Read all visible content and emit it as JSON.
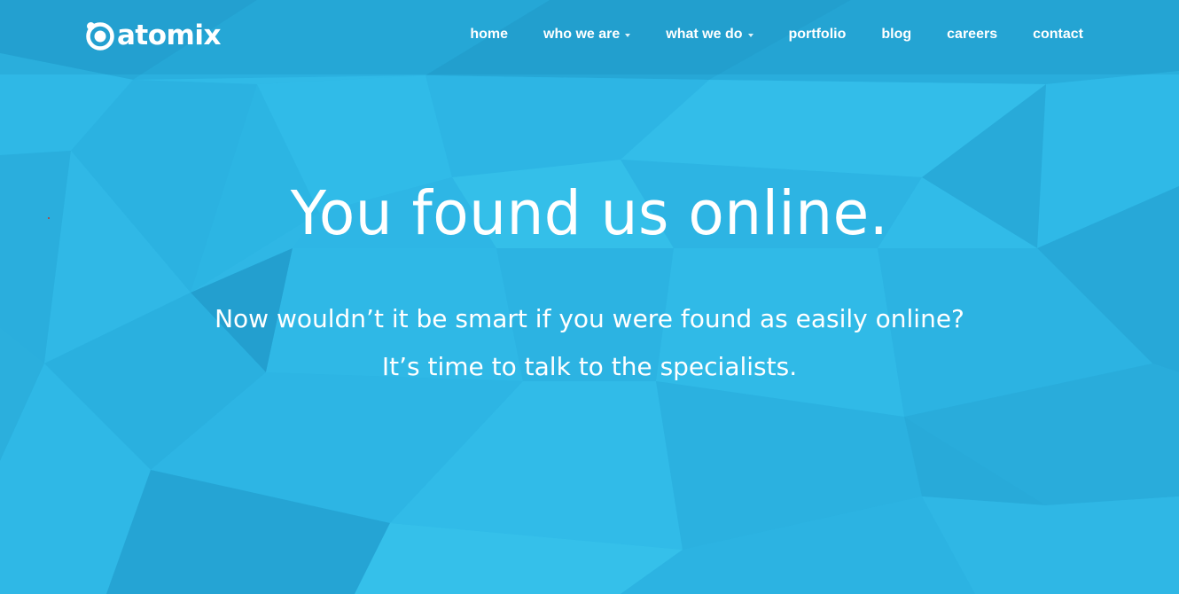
{
  "brand": {
    "name": "atomix"
  },
  "nav": {
    "items": [
      {
        "label": "home",
        "has_dropdown": false
      },
      {
        "label": "who we are",
        "has_dropdown": true
      },
      {
        "label": "what we do",
        "has_dropdown": true
      },
      {
        "label": "portfolio",
        "has_dropdown": false
      },
      {
        "label": "blog",
        "has_dropdown": false
      },
      {
        "label": "careers",
        "has_dropdown": false
      },
      {
        "label": "contact",
        "has_dropdown": false
      }
    ]
  },
  "hero": {
    "headline": "You found us online.",
    "subline_1": "Now wouldn’t it be smart if you were found as easily online?",
    "subline_2": "It’s time to talk to the specialists."
  },
  "colors": {
    "background": "#2cb5e3",
    "text": "#ffffff"
  },
  "icons": {
    "logo_mark": "atom-logo-icon",
    "dropdown": "caret-down-icon"
  }
}
